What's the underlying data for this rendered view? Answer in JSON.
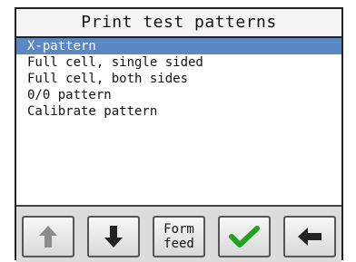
{
  "window": {
    "title": "Print test patterns"
  },
  "menu": {
    "selected_index": 0,
    "items": [
      {
        "label": "X-pattern"
      },
      {
        "label": "Full cell, single sided"
      },
      {
        "label": "Full cell, both sides"
      },
      {
        "label": "0/0 pattern"
      },
      {
        "label": "Calibrate pattern"
      }
    ]
  },
  "toolbar": {
    "form_feed_line1": "Form",
    "form_feed_line2": "feed",
    "icons": {
      "up": "arrow-up-icon",
      "down": "arrow-down-icon",
      "ok": "checkmark-icon",
      "back": "arrow-left-icon"
    }
  },
  "colors": {
    "selection": "#5b87c2",
    "check": "#1fa31f",
    "disabled_arrow": "#8c8c8c",
    "arrow": "#222222"
  }
}
